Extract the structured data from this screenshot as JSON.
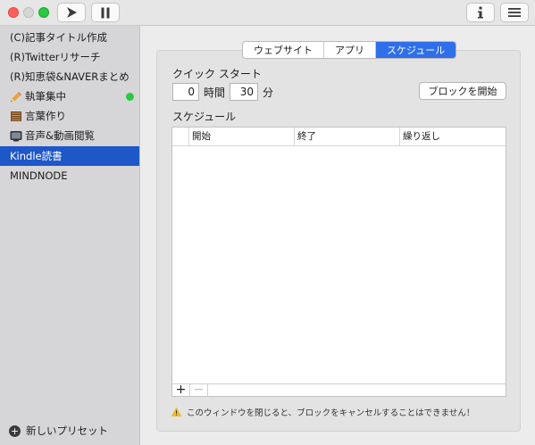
{
  "toolbar": {
    "play_icon": "play-arrow-icon",
    "pause_icon": "pause-icon",
    "info_icon": "info-icon",
    "menu_icon": "hamburger-menu-icon"
  },
  "sidebar": {
    "items": [
      {
        "label": "(C)記事タイトル作成"
      },
      {
        "label": "(R)Twitterリサーチ"
      },
      {
        "label": "(R)知恵袋&NAVERまとめ"
      },
      {
        "label": "執筆集中",
        "icon": "pencil-icon",
        "active_dot": true
      },
      {
        "label": "言葉作り",
        "icon": "book-icon"
      },
      {
        "label": "音声&動画閲覧",
        "icon": "tv-icon"
      },
      {
        "label": "Kindle読書",
        "selected": true
      },
      {
        "label": "MINDNODE"
      }
    ],
    "new_preset_label": "新しいプリセット"
  },
  "tabs": {
    "website": "ウェブサイト",
    "apps": "アプリ",
    "schedule": "スケジュール",
    "active": "schedule"
  },
  "quick_start": {
    "title": "クイック スタート",
    "hours_value": "0",
    "hours_label": "時間",
    "minutes_value": "30",
    "minutes_label": "分",
    "start_block_button": "ブロックを開始"
  },
  "schedule": {
    "title": "スケジュール",
    "columns": [
      "開始",
      "終了",
      "繰り返し"
    ],
    "rows": [],
    "add_label": "+",
    "remove_label": "−"
  },
  "warning": {
    "text": "このウィンドウを閉じると、ブロックをキャンセルすることはできません！"
  },
  "colors": {
    "accent": "#2f6fe9",
    "sidebar_selected": "#1e57c8",
    "active_dot": "#2ac940"
  }
}
